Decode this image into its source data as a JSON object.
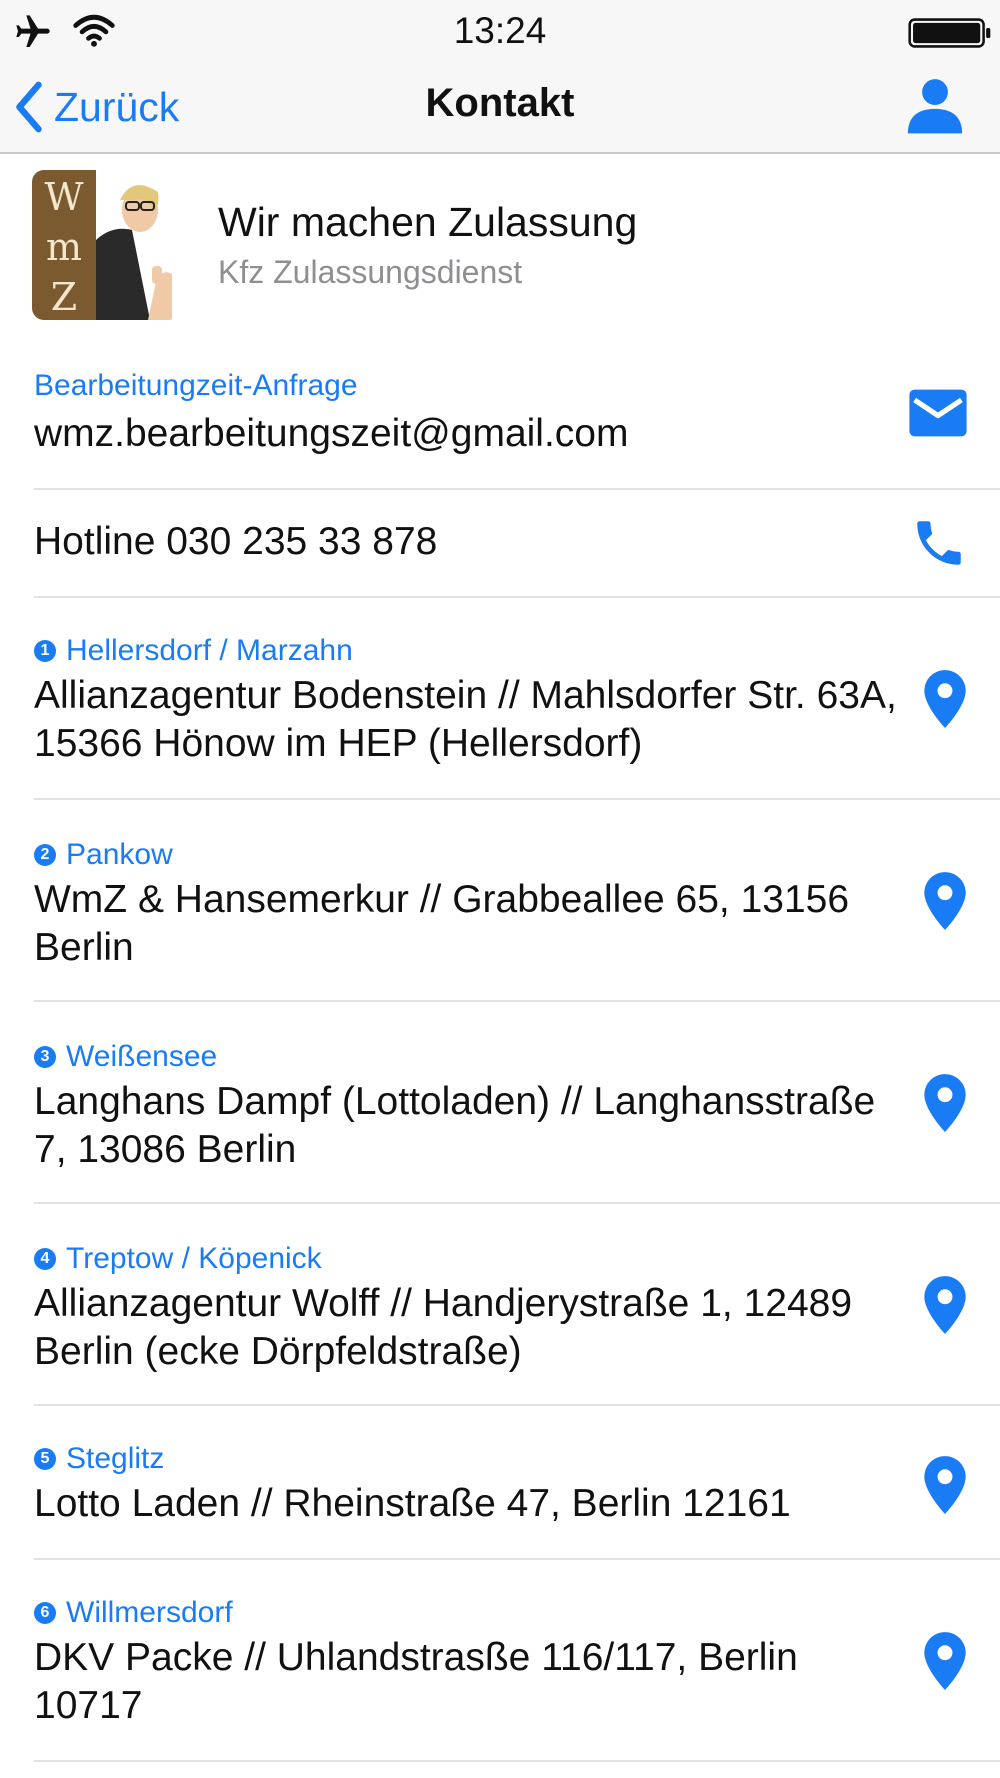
{
  "status_bar": {
    "time": "13:24"
  },
  "nav": {
    "back_label": "Zurück",
    "title": "Kontakt"
  },
  "header": {
    "company_name": "Wir machen Zulassung",
    "subtitle": "Kfz Zulassungsdienst",
    "logo_letters": [
      "W",
      "m",
      "Z"
    ]
  },
  "contacts": {
    "email": {
      "label": "Bearbeitungzeit-Anfrage",
      "value": "wmz.bearbeitungszeit@gmail.com",
      "icon": "mail-icon"
    },
    "hotline": {
      "value": "Hotline 030 235 33 878",
      "icon": "phone-icon"
    }
  },
  "locations": [
    {
      "num": "1",
      "name": "Hellersdorf / Marzahn",
      "address": "Allianzagentur Bodenstein // Mahlsdorfer Str. 63A, 15366 Hönow im HEP (Hellersdorf)"
    },
    {
      "num": "2",
      "name": "Pankow",
      "address": "WmZ & Hansemerkur // Grabbeallee 65, 13156 Berlin"
    },
    {
      "num": "3",
      "name": "Weißensee",
      "address": "Langhans Dampf (Lottoladen) // Langhansstraße 7, 13086 Berlin"
    },
    {
      "num": "4",
      "name": "Treptow / Köpenick",
      "address": "Allianzagentur Wolff // Handjerystraße 1, 12489 Berlin (ecke Dörpfeldstraße)"
    },
    {
      "num": "5",
      "name": "Steglitz",
      "address": "Lotto Laden // Rheinstraße 47, Berlin 12161"
    },
    {
      "num": "6",
      "name": "Willmersdorf",
      "address": "DKV Packe // Uhlandstrasße 116/117, Berlin 10717"
    }
  ],
  "colors": {
    "accent": "#1a7cf5",
    "separator": "#e3e3e6",
    "logo_brown": "#7a5a2e"
  }
}
